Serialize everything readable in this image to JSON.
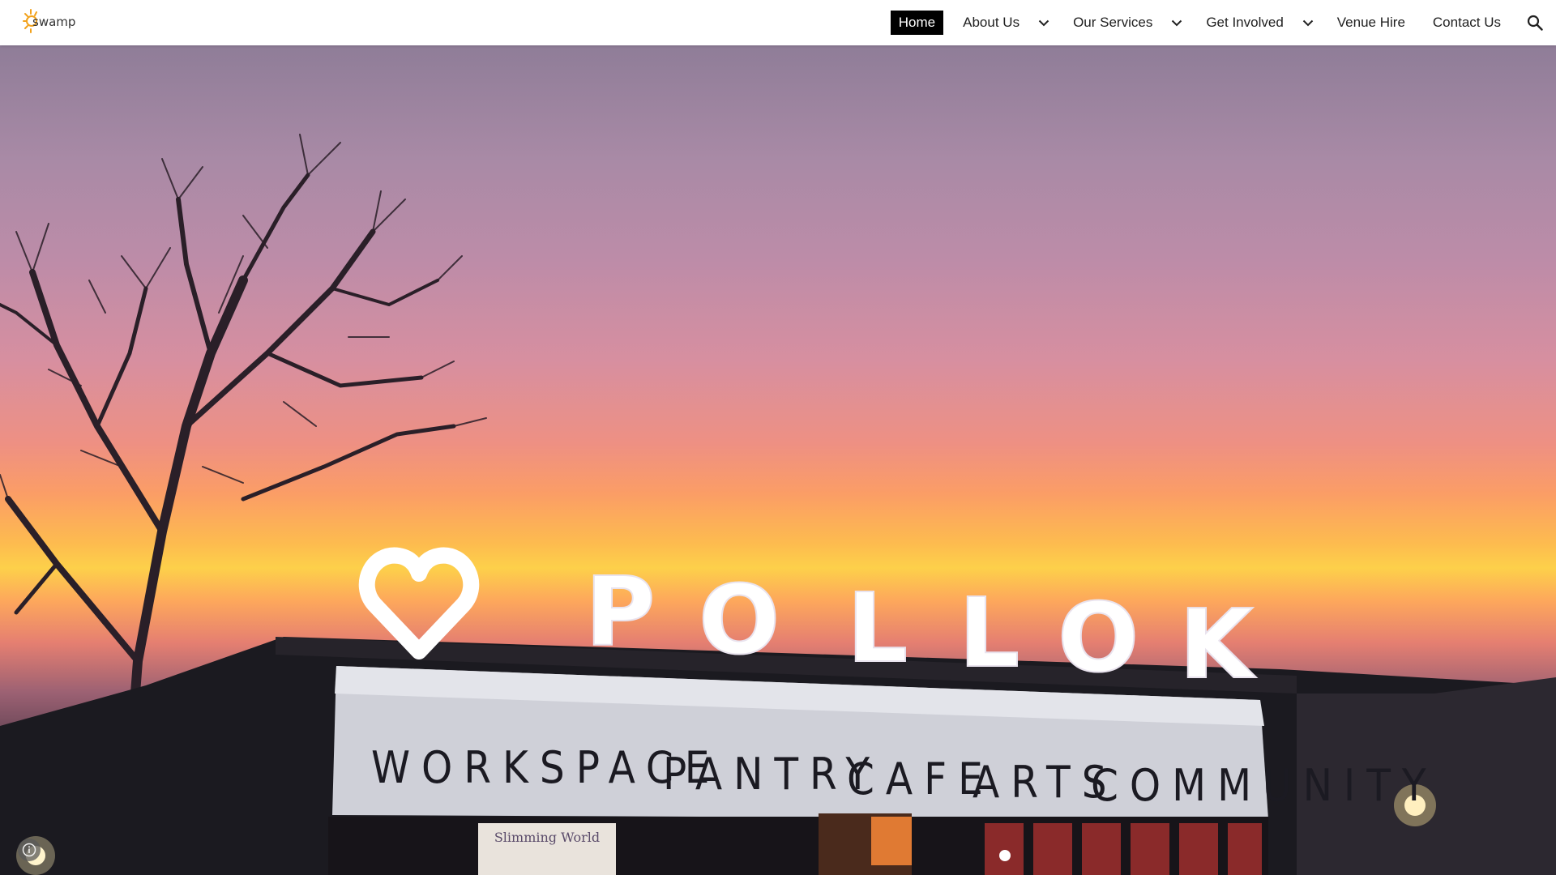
{
  "brand": {
    "logo_text": "swamp",
    "logo_icon": "sun-logo"
  },
  "nav": {
    "items": [
      {
        "label": "Home",
        "active": true,
        "has_dropdown": false
      },
      {
        "label": "About Us",
        "active": false,
        "has_dropdown": true
      },
      {
        "label": "Our Services",
        "active": false,
        "has_dropdown": true
      },
      {
        "label": "Get Involved",
        "active": false,
        "has_dropdown": true
      },
      {
        "label": "Venue Hire",
        "active": false,
        "has_dropdown": false
      },
      {
        "label": "Contact Us",
        "active": false,
        "has_dropdown": false
      }
    ],
    "search_icon": "search-icon",
    "active_bg": "#000000",
    "text_color": "#212121"
  },
  "hero": {
    "sign_letters": [
      "P",
      "O",
      "L",
      "L",
      "O",
      "K"
    ],
    "sign_icon": "heart-icon",
    "facade_words": [
      "WORKSPACE",
      "PANTRY",
      "CAFE",
      "ARTS",
      "COMMUNITY"
    ],
    "banner_text": "Slimming World",
    "scroll_icon": "chevron-down-icon",
    "info_icon": "info-icon"
  }
}
